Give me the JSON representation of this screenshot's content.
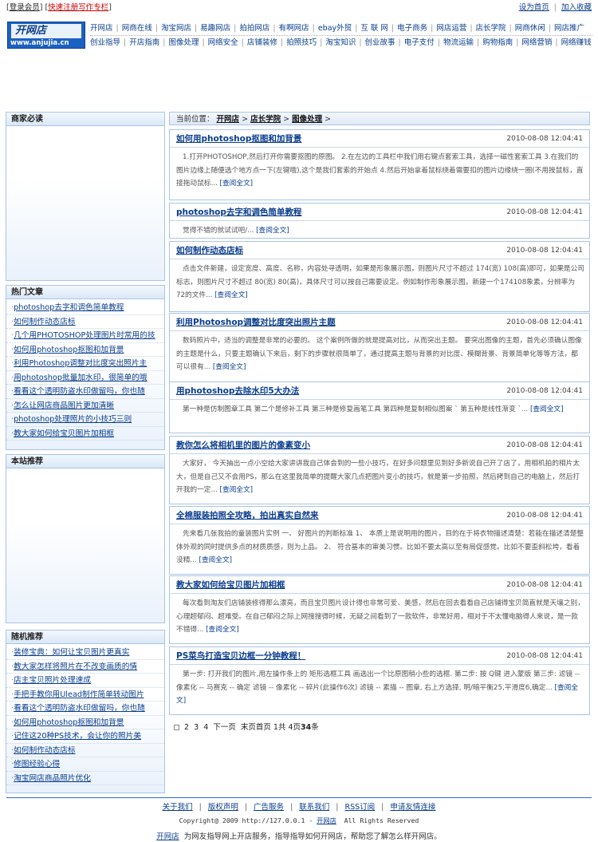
{
  "top": {
    "login": "登录会员",
    "register": "快速注册写作专栏",
    "set_home": "设为首页",
    "favorite": "加入收藏"
  },
  "logo": {
    "cn": "开网店",
    "url": "www.anjujia.cn"
  },
  "nav": {
    "row1": [
      "开网店",
      "网商在线",
      "淘宝网店",
      "易趣网店",
      "拍拍网店",
      "有啊网店",
      "ebay外贸",
      "互 联 网",
      "电子商务",
      "网店运营",
      "店长学院",
      "网商休闲"
    ],
    "row1_hot": "网店推广",
    "row2": [
      "创业指导",
      "开店指南",
      "图像处理",
      "网络安全",
      "店铺装修",
      "拍照技巧",
      "淘宝知识",
      "创业故事",
      "电子支付",
      "物流运输",
      "购物指南",
      "网络营销"
    ],
    "row2_hot": "网络赚钱"
  },
  "sidebar": {
    "box1": {
      "title": "商家必读"
    },
    "box2": {
      "title": "热门文章",
      "items": [
        "photoshop去字和调色简单教程",
        "如何制作动态店标",
        "几个用PHOTOSHOP处理图片时常用的技",
        "如何用photoshop抠图和加背景",
        "利用Photoshop调整对比度突出照片主",
        "用photoshop批量加水印，很简单的哦",
        "看看这个透明防盗水印做留吗，你也随",
        "怎么让网店商品图片更加清晰",
        "photoshop处理照片的小技巧三则",
        "教大家如何给宝贝图片加相框"
      ]
    },
    "box3": {
      "title": "本站推荐"
    },
    "box4": {
      "title": "随机推荐",
      "items": [
        "装修宝典：如何让宝贝图片更真实",
        "教大家怎样将照片在不改变画质的情",
        "店主宝贝照片处理速成",
        "手把手教你用Ulead制作简单转动图片",
        "看看这个透明防盗水印做留吗，你也随",
        "如何用photoshop抠图和加背景",
        "记住这20种PS技术，会让你的照片美",
        "如何制作动态店标",
        "修图经验心得",
        "淘宝网店商品照片优化"
      ]
    }
  },
  "breadcrumb": {
    "prefix": "当前位置：",
    "items": [
      "开网店",
      "店长学院",
      "图像处理"
    ]
  },
  "articles": [
    {
      "title": "如何用photoshop抠图和加背景",
      "date": "2010-08-08 12:04:41",
      "summary": "1.打开PHOTOSHOP,然后打开你需要抠图的原图。 2.在左边的工具栏中我们用右键点套索工具，选择一磁性套索工具 3.在我们的图片边缘上随便选个地方点一下(左键哦),这个是我们套索的开始点 4.然后开始拿着鼠标绕着需要扣的图片边缘绕一圈(不用按鼠标，直接拖动鼠标..."
    },
    {
      "title": "photoshop去字和调色简单教程",
      "date": "2010-08-08 12:04:41",
      "summary": "觉得不错的就试试吧/..."
    },
    {
      "title": "如何制作动态店标",
      "date": "2010-08-08 12:04:41",
      "summary": "点击文件新建，设定宽度、高度、名称，内容处寻透明，如果是形象展示图，则图片尺寸不超过 174(宽) 108(高)即可，如果是公司标志，则图片尺寸不超过 80(宽) 80(高)，具体尺寸可以按自己需要设定。例如制作形象展示图，新建一个174108象素，分辨率为 72的文件..."
    },
    {
      "title": "利用Photoshop调整对比度突出照片主题",
      "date": "2010-08-08 12:04:41",
      "summary": "数码照片中，适当的调整是非常的必要的。 这个案例所做的就是提高对比，从而突出主题。 要突出图像的主题，首先必须确认图像的主题是什么，只要主题确认下来后，剩下的步骤就很简单了，通过提高主题与背景的对比度、模糊背景、背景简单化等等方法，都可以很有..."
    },
    {
      "title": "用photoshop去除水印5大办法",
      "date": "2010-08-08 12:04:41",
      "summary": "第一种是仿制图章工具 第二个是修补工具 第三种是修复画笔工具 第四种是复制相似图案 ` 第五种是线性渐变 `..."
    },
    {
      "title": "教你怎么将相机里的图片的像素变小",
      "date": "2010-08-08 12:04:41",
      "summary": "大家好， 今天抽出一点小空给大家讲讲我自己体会到的一些小技巧，在好多问题里见到好多新说自己开了店了，用相机拍的相片太大，但是自己又不会用PS，那么在这里我简单的提醒大家几点把图片变小的技巧，就是第一步拍照，然后拷到自己的电脑上，然后打开我的一定..."
    },
    {
      "title": "全棉服装拍照全攻略，拍出真实自然来",
      "date": "2010-08-08 12:04:41",
      "summary": "先来看几张我拍的童装图片实例 一、 好图片的判断标准 1、 本质上是说明用的图片，目的在于将衣物描述清楚：若能在描述清楚整体外观的同时提供多点的材质质感，则为上品。 2、 符合基本的审美习惯。比如不要太高以至有局促感觉。比如不要歪斜松垮，看着没精..."
    },
    {
      "title": "教大家如何给宝贝图片加相框",
      "date": "2010-08-08 12:04:41",
      "summary": "每次看到淘友们店铺装修得那么漂亮，而且宝贝图片设计得也非常可爱、美感，然后在回去看看自己店铺得宝贝简直就是天壤之别，心理超郁闷、超难受。在自己郁闷之际上网搜搜得时候，无疑之间看到了一款软件，非常好用，相对于不太懂电脑得人来说，是一款不错得..."
    },
    {
      "title": "PS菜鸟打造宝贝边框一分钟教程！",
      "date": "2010-08-08 12:04:41",
      "summary": "第一步: 打开我们的图片,用左操作条上的 矩形选框工具 画选出一个比原图稍小些的选框. 第二步: 按 Q键 进入蒙版 第三步: 滤镜 -- 像素化 -- 马赛克 -- 确定 滤镜 -- 像素化 -- 碎片(此操作6次) 滤镜 -- 素描 -- 图章, 右上方选择, 明/暗平衡25,平滑度6,确定..."
    }
  ],
  "read_more": "[查阅全文]",
  "pager": {
    "pages": [
      "2",
      "3",
      "4"
    ],
    "next": "下一页",
    "last": "末页",
    "first": "首页",
    "page_info": "1共",
    "count_pre": "4页",
    "count": "34",
    "count_suf": "条"
  },
  "footer": {
    "links": [
      "关于我们",
      "版权声明",
      "广告服务",
      "联系我们",
      "RSS订阅",
      "申请友情连接"
    ],
    "copyright_pre": "Copyright@ 2009 http://127.0.0.1 -",
    "copyright_link": "开网店",
    "copyright_post": "All Rights Reserved",
    "desc_link": "开网店",
    "desc": "为网友指导网上开店服务，指导指导如何开网店，帮助您了解怎么样开网店。"
  }
}
